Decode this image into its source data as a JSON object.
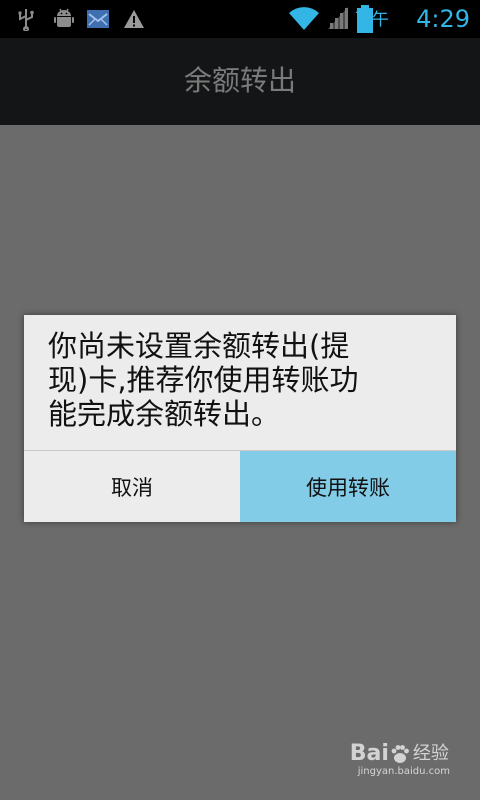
{
  "status_bar": {
    "ampm": "下午",
    "time": "4:29",
    "accent_color": "#33b5e5",
    "icons": [
      "usb-icon",
      "android-debug-icon",
      "mail-notification-icon",
      "warning-icon",
      "wifi-icon",
      "signal-icon",
      "battery-icon"
    ]
  },
  "action_bar": {
    "title": "余额转出"
  },
  "dialog": {
    "message": "你尚未设置余额转出(提现)卡,推荐你使用转账功能完成余额转出。",
    "cancel_label": "取消",
    "confirm_label": "使用转账",
    "confirm_color": "#82cce8"
  },
  "watermark": {
    "brand": "Bai",
    "brand_suffix": "经验",
    "url": "jingyan.baidu.com"
  }
}
